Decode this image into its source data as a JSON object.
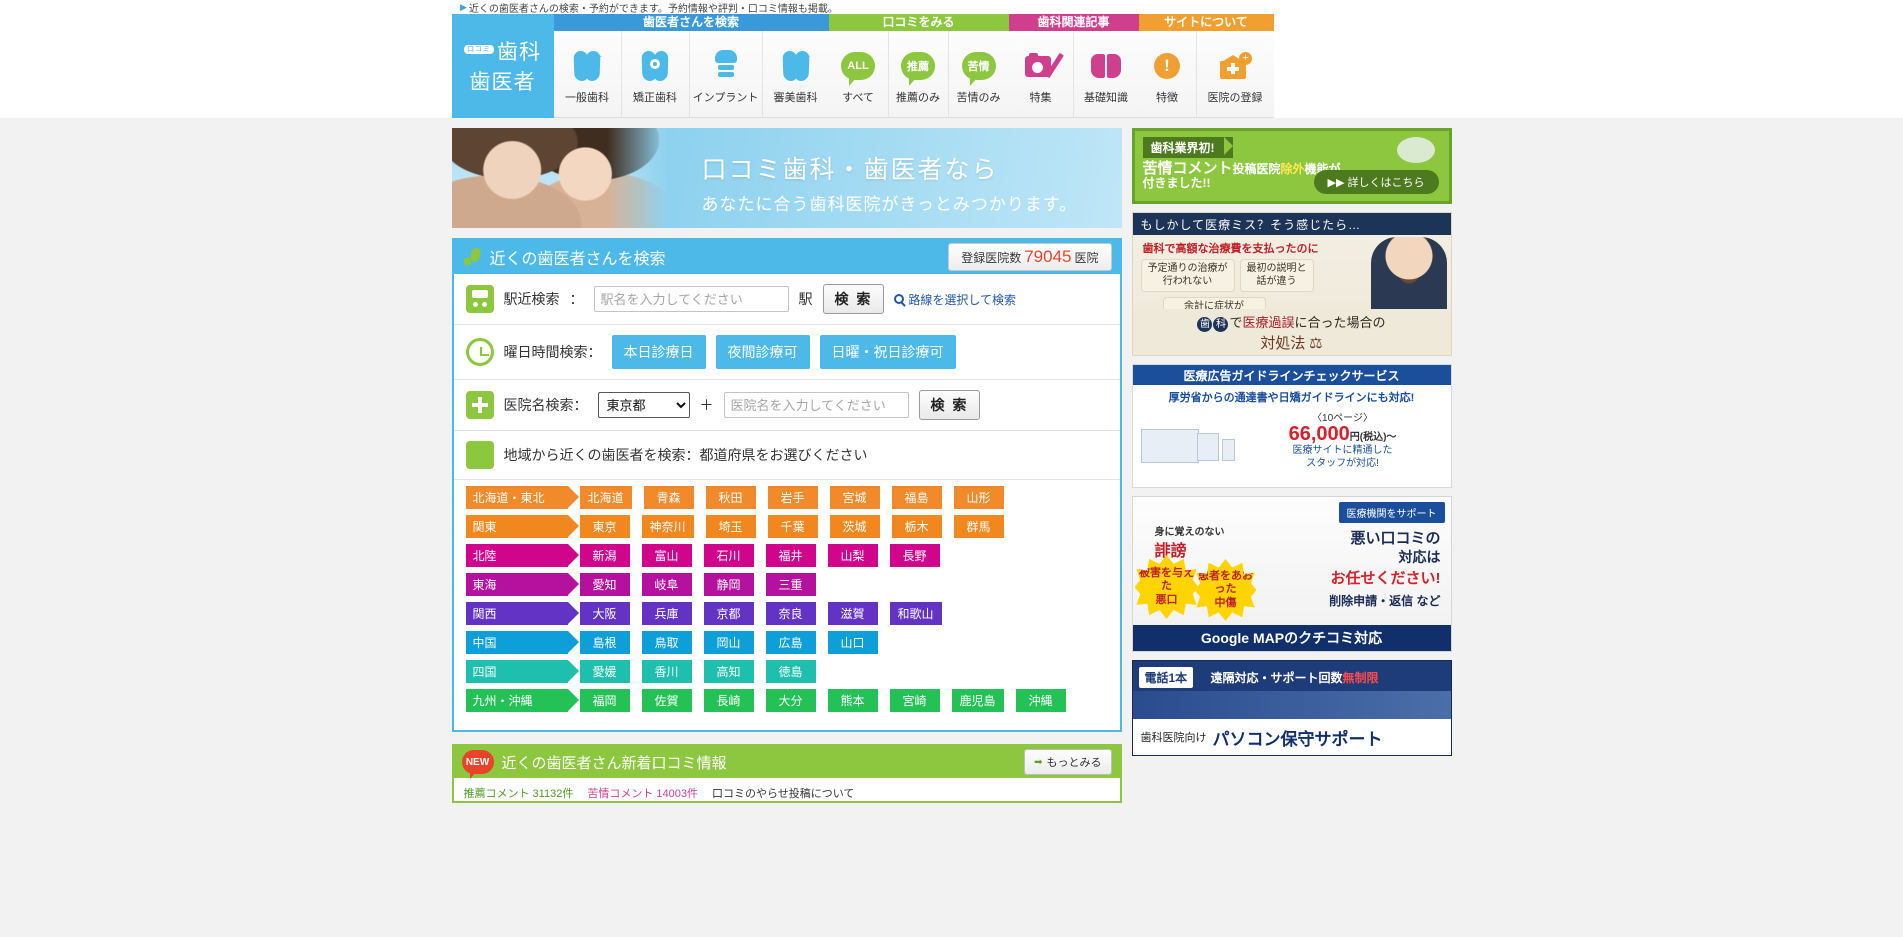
{
  "tagline": "近くの歯医者さんの検索・予約ができます。予約情報や評判・口コミ情報も掲載。",
  "logo": {
    "badge": "口コミ",
    "line1": "歯科",
    "line2": "歯医者"
  },
  "nav_groups": [
    {
      "title": "歯医者さんを検索",
      "color": "#3a9ad9",
      "items": [
        {
          "label": "一般歯科",
          "icon": "tooth-icon"
        },
        {
          "label": "矯正歯科",
          "icon": "braces-tooth-icon"
        },
        {
          "label": "インプラント",
          "icon": "implant-icon"
        },
        {
          "label": "審美歯科",
          "icon": "sparkle-tooth-icon"
        }
      ]
    },
    {
      "title": "口コミをみる",
      "color": "#8dc63f",
      "items": [
        {
          "label": "すべて",
          "icon": "speech-bubble-icon",
          "bubble": "ALL"
        },
        {
          "label": "推薦のみ",
          "icon": "speech-bubble-icon",
          "bubble": "推薦"
        },
        {
          "label": "苦情のみ",
          "icon": "speech-bubble-icon",
          "bubble": "苦情"
        }
      ]
    },
    {
      "title": "歯科関連記事",
      "color": "#cf3f8e",
      "items": [
        {
          "label": "特集",
          "icon": "camera-pencil-icon"
        },
        {
          "label": "基礎知識",
          "icon": "book-icon"
        }
      ]
    },
    {
      "title": "サイトについて",
      "color": "#f0a030",
      "items": [
        {
          "label": "特徴",
          "icon": "exclamation-icon"
        },
        {
          "label": "医院の登録",
          "icon": "clinic-plus-icon"
        }
      ]
    }
  ],
  "hero": {
    "line1": "口コミ歯科・歯医者なら",
    "line2": "あなたに合う歯科医院がきっとみつかります。"
  },
  "search_panel": {
    "title": "近くの歯医者さんを検索",
    "count_prefix": "登録医院数",
    "count_value": "79045",
    "count_suffix": "医院",
    "station": {
      "label": "駅近検索",
      "colon": "：",
      "placeholder": "駅名を入力してください",
      "suffix": "駅",
      "button": "検 索",
      "route_link": "路線を選択して検索"
    },
    "daytime": {
      "label": "曜日時間検索：",
      "options": [
        "本日診療日",
        "夜間診療可",
        "日曜・祝日診療可"
      ]
    },
    "clinic_name": {
      "label": "医院名検索：",
      "selected_pref": "東京都",
      "plus": "＋",
      "placeholder": "医院名を入力してください",
      "button": "検 索"
    },
    "region_heading": "地域から近くの歯医者を検索：都道府県をお選びください"
  },
  "regions": [
    {
      "name": "北海道・東北",
      "color": "#f08a2a",
      "prefs": [
        "北海道",
        "青森",
        "秋田",
        "岩手",
        "宮城",
        "福島",
        "山形"
      ]
    },
    {
      "name": "関東",
      "color": "#f0871f",
      "prefs": [
        "東京",
        "神奈川",
        "埼玉",
        "千葉",
        "茨城",
        "栃木",
        "群馬"
      ]
    },
    {
      "name": "北陸",
      "color": "#d1058c",
      "prefs": [
        "新潟",
        "富山",
        "石川",
        "福井",
        "山梨",
        "長野"
      ]
    },
    {
      "name": "東海",
      "color": "#b4119e",
      "prefs": [
        "愛知",
        "岐阜",
        "静岡",
        "三重"
      ]
    },
    {
      "name": "関西",
      "color": "#6333c4",
      "prefs": [
        "大阪",
        "兵庫",
        "京都",
        "奈良",
        "滋賀",
        "和歌山"
      ]
    },
    {
      "name": "中国",
      "color": "#0e9fd8",
      "prefs": [
        "島根",
        "鳥取",
        "岡山",
        "広島",
        "山口"
      ]
    },
    {
      "name": "四国",
      "color": "#1fbfae",
      "prefs": [
        "愛媛",
        "香川",
        "高知",
        "徳島"
      ]
    },
    {
      "name": "九州・沖縄",
      "color": "#24c256",
      "prefs": [
        "福岡",
        "佐賀",
        "長崎",
        "大分",
        "熊本",
        "宮崎",
        "鹿児島",
        "沖縄"
      ]
    }
  ],
  "news": {
    "badge": "NEW",
    "title": "近くの歯医者さん新着口コミ情報",
    "more_button": "もっとみる",
    "links": [
      "推薦コメント 31132件",
      "苦情コメント 14003件",
      "口コミのやらせ投稿について"
    ]
  },
  "ads": {
    "ad1": {
      "ribbon": "歯科業界初!",
      "line1_a": "苦情コメント",
      "line1_b": "投稿医院",
      "line1_c": "除外",
      "line1_d": "機能が",
      "line2": "付きました!!",
      "cta": "▶▶ 詳しくはこちら"
    },
    "ad2": {
      "top": "もしかして医療ミス？そう感じたら…",
      "red": "歯科で高額な治療費を支払ったのに",
      "chips": [
        "予定通りの治療が\n行われない",
        "最初の説明と\n話が違う",
        "余計に症状が\n悪くなってしまった"
      ],
      "bottom1_a": "歯",
      "bottom1_b": "科",
      "bottom1_c": "で",
      "bottom1_d": "医療過誤",
      "bottom1_e": "に合った場合の",
      "bottom2": "対処法 ⚖"
    },
    "ad3": {
      "head": "医療広告ガイドラインチェックサービス",
      "line1": "厚労省からの通達書や日矯ガイドラインにも対応!",
      "pages": "〈10ページ〉",
      "price": "66,000",
      "price_unit": "円(税込)〜",
      "note": "医療サイトに精通した\nスタッフが対応!"
    },
    "ad4": {
      "tab": "医療機関をサポート",
      "highlight": "誹謗",
      "sub": "身に覚えのない",
      "burst_left": "被害を与えた\n悪口",
      "burst_right": "患者をあおった\n中傷",
      "line1": "悪い口コミの",
      "line2": "対応は",
      "line3": "お任せください!",
      "line4": "削除申請・返信 など",
      "bottom": "Google MAPのクチコミ対応"
    },
    "ad5": {
      "tel": "電話1本",
      "headline_a": "遠隔対応・サポート回数",
      "headline_b": "無制限",
      "band1": "歯科医院向け",
      "band2": "パソコン保守サポート"
    }
  }
}
